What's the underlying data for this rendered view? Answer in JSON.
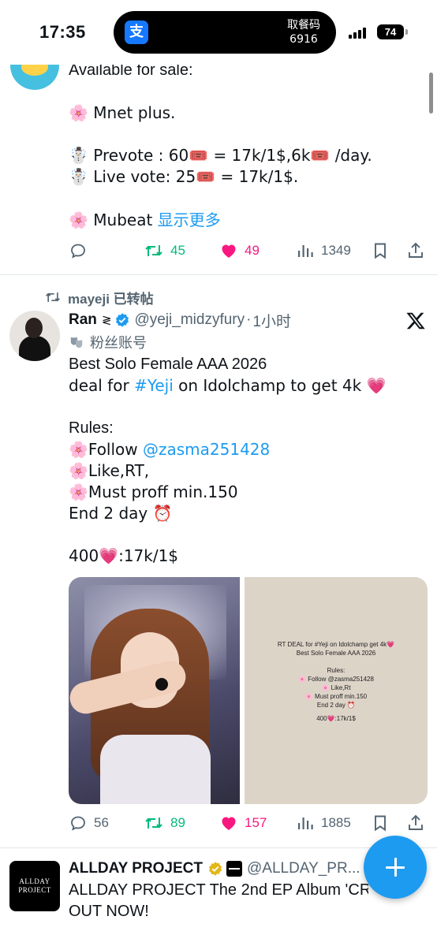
{
  "status_bar": {
    "time": "17:35",
    "island_title": "取餐码",
    "island_code": "6916",
    "battery": "74"
  },
  "tweet1": {
    "lines": [
      "Available for sale:",
      "🌸 Mnet plus.",
      "☃️ Prevote : 60🎟️ = 17k/1$,6k🎟️ /day.",
      "☃️ Live vote: 25🎟️ = 17k/1$.",
      "🌸 Mubeat"
    ],
    "show_more": "显示更多",
    "reposts": "45",
    "likes": "49",
    "views": "1349"
  },
  "repost_label": "mayeji 已转帖",
  "tweet2": {
    "display_name": "Ran",
    "name_symbol": "≷",
    "handle": "@yeji_midzyfury",
    "separator": "·",
    "time": "1小时",
    "fan_label": "粉丝账号",
    "line1": "Best Solo Female  AAA 2026",
    "line2_prefix": "deal for ",
    "line2_hashtag": "#Yeji",
    "line2_suffix": " on Idolchamp to get 4k 💗",
    "rules_header": "Rules:",
    "rule1_prefix": "🌸Follow ",
    "rule1_mention": "@zasma251428",
    "rule2": "🌸Like,RT,",
    "rule3": "🌸Must proff min.150",
    "end_line": "End 2 day ⏰",
    "price_line": "400💗:17k/1$",
    "image_text": [
      "RT DEAL for #Yeji on Idolchamp get 4k💗",
      "Best Solo Female  AAA 2026",
      "Rules:",
      "🌸 Follow @zasma251428",
      "🌸 Like,Rt",
      "🌸 Must proff min.150",
      "End 2 day ⏰",
      "400💗:17k/1$"
    ],
    "replies": "56",
    "reposts": "89",
    "likes": "157",
    "views": "1885"
  },
  "tweet3": {
    "display_name": "ALLDAY PROJECT",
    "handle": "@ALLDAY_PR...",
    "avatar_line1": "ALLDAY",
    "avatar_line2": "PROJECT",
    "line1": "ALLDAY PROJECT The 2nd EP Album 'CRA",
    "line2": "OUT NOW!"
  },
  "colors": {
    "accent": "#1d9bf0",
    "repost_green": "#00ba7c",
    "like_pink": "#f91880",
    "muted": "#536471"
  }
}
